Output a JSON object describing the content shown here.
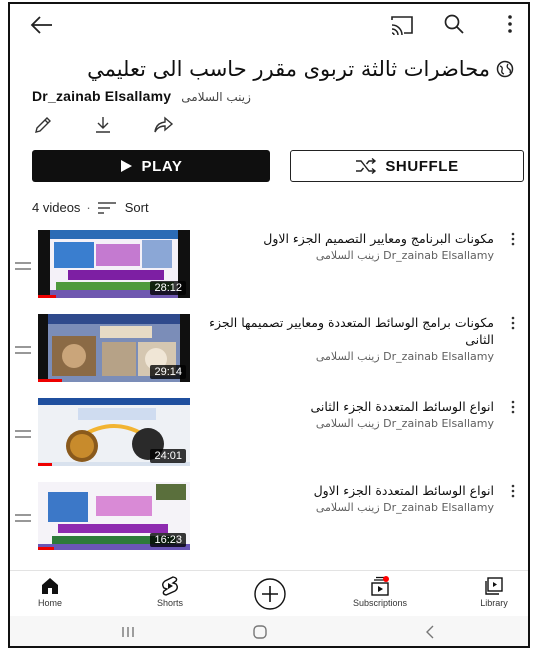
{
  "playlist": {
    "title": "محاضرات ثالثة تربوى مقرر حاسب الى تعليمي",
    "owner_en": "Dr_zainab Elsallamy",
    "owner_ar": "زينب السلامى",
    "video_count": "4 videos",
    "sort_label": "Sort"
  },
  "buttons": {
    "play": "PLAY",
    "shuffle": "SHUFFLE"
  },
  "videos": [
    {
      "title": "مكونات البرنامج ومعايير التصميم الجزء الاول",
      "channel": "زينب السلامى Dr_zainab Elsallamy",
      "duration": "28:12"
    },
    {
      "title": "مكونات برامج الوسائط المتعددة ومعايير تصميمها الجزء الثانى",
      "channel": "زينب السلامى Dr_zainab Elsallamy",
      "duration": "29:14"
    },
    {
      "title": "انواع الوسائط المتعددة الجزء الثانى",
      "channel": "زينب السلامى Dr_zainab Elsallamy",
      "duration": "24:01"
    },
    {
      "title": "انواع الوسائط المتعددة الجزء الاول",
      "channel": "زينب السلامى Dr_zainab Elsallamy",
      "duration": "16:23"
    }
  ],
  "nav": {
    "home": "Home",
    "shorts": "Shorts",
    "subscriptions": "Subscriptions",
    "library": "Library"
  },
  "colors": {
    "accent_red": "#ff0000",
    "play_bg": "#0f0f0f"
  }
}
